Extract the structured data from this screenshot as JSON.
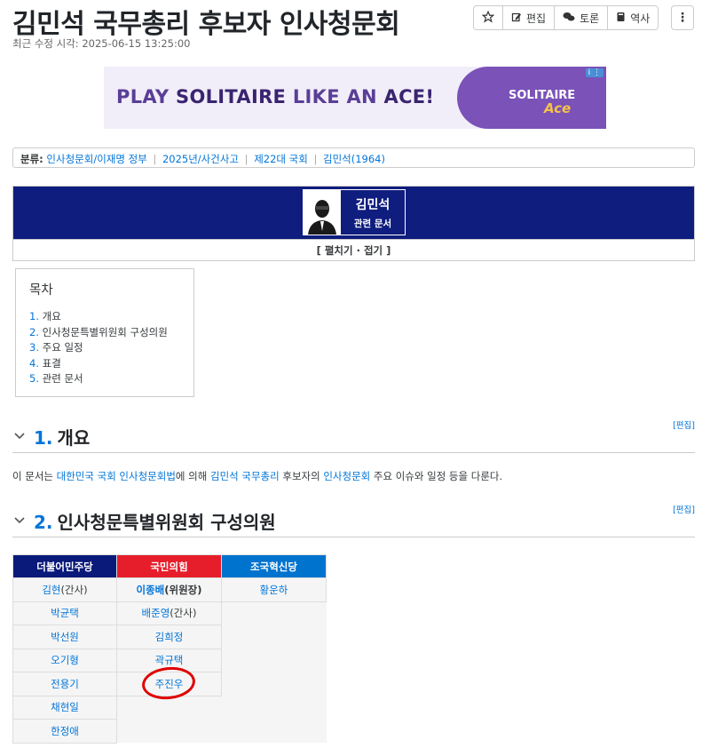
{
  "page": {
    "title": "김민석 국무총리 후보자 인사청문회",
    "last_modified_label": "최근 수정 시각:",
    "last_modified": "2025-06-15 13:25:00"
  },
  "toolbar": {
    "star_icon": "star-icon",
    "edit_label": "편집",
    "discuss_label": "토론",
    "history_label": "역사",
    "more_label": "⋮"
  },
  "ad": {
    "text_part1": "PLAY",
    "text_part2": "SOLITAIRE",
    "text_part3": "LIKE AN",
    "text_part4": "ACE!",
    "logo_line1": "SOLITAIRE",
    "logo_line2": "Ace",
    "info": "i ⋮"
  },
  "categories": {
    "label": "분류:",
    "items": [
      "인사청문회/이재명 정부",
      "2025년/사건사고",
      "제22대 국회",
      "김민석(1964)"
    ]
  },
  "folding": {
    "name": "김민석",
    "sub": "관련 문서",
    "toggle": "[ 펼치기 · 접기 ]"
  },
  "toc": {
    "title": "목차",
    "items": [
      {
        "num": "1.",
        "label": "개요"
      },
      {
        "num": "2.",
        "label": "인사청문특별위원회 구성의원"
      },
      {
        "num": "3.",
        "label": "주요 일정"
      },
      {
        "num": "4.",
        "label": "표결"
      },
      {
        "num": "5.",
        "label": "관련 문서"
      }
    ]
  },
  "sections": [
    {
      "num": "1.",
      "title": "개요",
      "edit": "[편집]"
    },
    {
      "num": "2.",
      "title": "인사청문특별위원회 구성의원",
      "edit": "[편집]"
    }
  ],
  "overview": {
    "t1": "이 문서는 ",
    "l1": "대한민국 국회 인사청문회법",
    "t2": "에 의해 ",
    "l2": "김민석 국무총리",
    "t3": " 후보자의 ",
    "l3": "인사청문회",
    "t4": " 주요 이슈와 일정 등을 다룬다."
  },
  "members": {
    "colors": {
      "democratic": "#0a1a7a",
      "ppp": "#e61e2b",
      "rebuilding": "#0073cf"
    },
    "headers": [
      "더불어민주당",
      "국민의힘",
      "조국혁신당"
    ],
    "democratic": [
      {
        "name": "김현",
        "role": "(간사)"
      },
      {
        "name": "박균택",
        "role": ""
      },
      {
        "name": "박선원",
        "role": ""
      },
      {
        "name": "오기형",
        "role": ""
      },
      {
        "name": "전용기",
        "role": ""
      },
      {
        "name": "채현일",
        "role": ""
      },
      {
        "name": "한정애",
        "role": ""
      }
    ],
    "ppp": [
      {
        "name": "이종배",
        "role": "(위원장)"
      },
      {
        "name": "배준영",
        "role": "(간사)"
      },
      {
        "name": "김희정",
        "role": ""
      },
      {
        "name": "곽규택",
        "role": ""
      },
      {
        "name": "주진우",
        "role": ""
      }
    ],
    "rebuilding": [
      {
        "name": "황운하",
        "role": ""
      }
    ]
  }
}
